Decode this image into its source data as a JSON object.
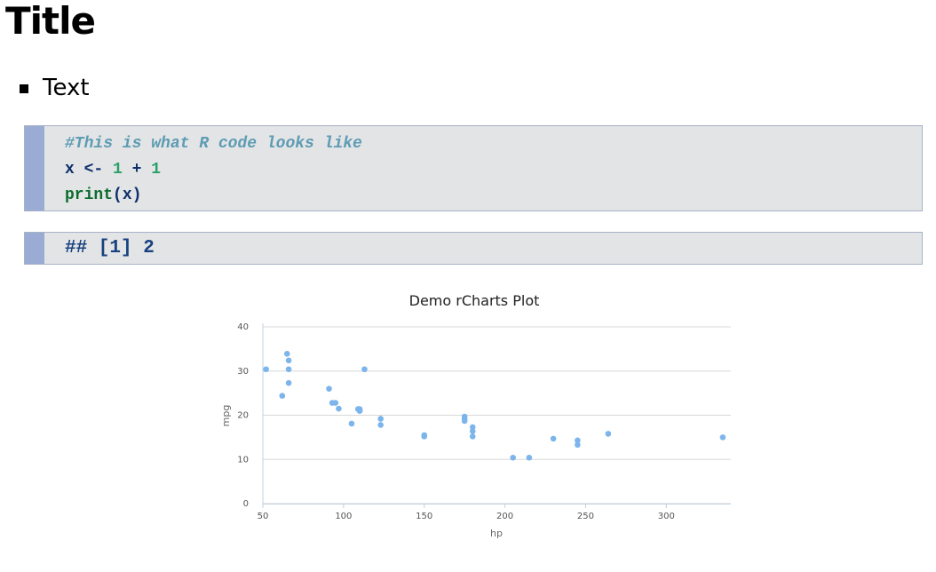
{
  "page": {
    "title": "Title",
    "bullets": [
      "Text"
    ]
  },
  "code": {
    "comment": "#This is what R code looks like",
    "line2": {
      "var": "x",
      "assign": "<-",
      "num1": "1",
      "plus": "+",
      "num2": "1"
    },
    "line3": {
      "fn": "print",
      "open": "(",
      "arg": "x",
      "close": ")"
    },
    "output": "## [1] 2"
  },
  "colors": {
    "code_background": "#e3e4e6",
    "code_gutter": "#9aacd3",
    "code_border": "#a7b3c8",
    "comment": "#5d9cb3",
    "number": "#2aa069",
    "function": "#0d6c2e",
    "identifier": "#0e2f6b",
    "point": "#7cb5ec",
    "gridline": "#d8d8d8"
  },
  "chart_data": {
    "type": "scatter",
    "title": "Demo rCharts Plot",
    "xlabel": "hp",
    "ylabel": "mpg",
    "xlim": [
      50,
      340
    ],
    "ylim": [
      0,
      40
    ],
    "xticks": [
      50,
      100,
      150,
      200,
      250,
      300
    ],
    "yticks": [
      0,
      10,
      20,
      30,
      40
    ],
    "grid": true,
    "legend": "none",
    "x": [
      52,
      62,
      65,
      66,
      66,
      66,
      91,
      93,
      95,
      97,
      105,
      109,
      110,
      110,
      110,
      113,
      123,
      123,
      150,
      150,
      175,
      175,
      175,
      180,
      180,
      180,
      205,
      215,
      230,
      245,
      245,
      264,
      335
    ],
    "y": [
      30.4,
      24.4,
      33.9,
      32.4,
      30.4,
      27.3,
      26.0,
      22.8,
      22.8,
      21.5,
      18.1,
      21.4,
      21.0,
      21.0,
      21.4,
      30.4,
      19.2,
      17.8,
      15.5,
      15.2,
      18.7,
      19.2,
      19.7,
      16.4,
      17.3,
      15.2,
      10.4,
      10.4,
      14.7,
      14.3,
      13.3,
      15.8,
      15.0
    ]
  }
}
